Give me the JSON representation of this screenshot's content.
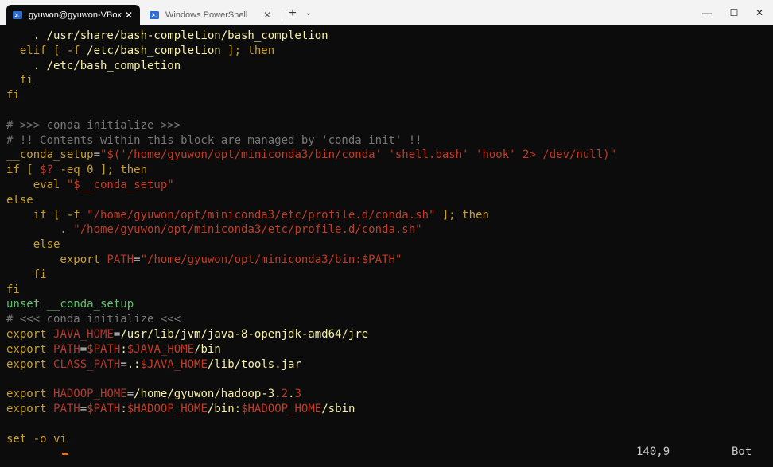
{
  "tabs": [
    {
      "title": "gyuwon@gyuwon-VBox:",
      "active": true
    },
    {
      "title": "Windows PowerShell",
      "active": false
    }
  ],
  "tabbar": {
    "new_tab": "+",
    "dropdown": "⌄",
    "close": "✕"
  },
  "window_controls": {
    "minimize": "—",
    "maximize": "☐",
    "close": "✕"
  },
  "colors": {
    "default": "#cccccc",
    "keyword": "#c7a030",
    "string": "#c23b22",
    "comment": "#767676",
    "var": "#b03a2e",
    "path": "#f9f1a5",
    "cyan": "#3a96dd",
    "green": "#61c16b"
  },
  "lines": [
    [
      {
        "t": "    . /usr/share/bash-completion/bash_completion",
        "c": "path"
      }
    ],
    [
      {
        "t": "  elif [ -f ",
        "c": "keyword"
      },
      {
        "t": "/etc/bash_completion",
        "c": "path"
      },
      {
        "t": " ]; then",
        "c": "keyword"
      }
    ],
    [
      {
        "t": "    . /etc/bash_completion",
        "c": "path"
      }
    ],
    [
      {
        "t": "  fi",
        "c": "keyword"
      }
    ],
    [
      {
        "t": "fi",
        "c": "keyword"
      }
    ],
    [
      {
        "t": "",
        "c": "default"
      }
    ],
    [
      {
        "t": "# >>> conda initialize >>>",
        "c": "comment"
      }
    ],
    [
      {
        "t": "# !! Contents within this block are managed by 'conda init' !!",
        "c": "comment"
      }
    ],
    [
      {
        "t": "__conda_setup",
        "c": "keyword"
      },
      {
        "t": "=",
        "c": "default"
      },
      {
        "t": "\"$('/home/gyuwon/opt/miniconda3/bin/conda' 'shell.bash' 'hook' 2> /dev/null)\"",
        "c": "string"
      }
    ],
    [
      {
        "t": "if [ ",
        "c": "keyword"
      },
      {
        "t": "$?",
        "c": "var"
      },
      {
        "t": " -eq 0 ]; then",
        "c": "keyword"
      }
    ],
    [
      {
        "t": "    eval ",
        "c": "keyword"
      },
      {
        "t": "\"$__conda_setup\"",
        "c": "string"
      }
    ],
    [
      {
        "t": "else",
        "c": "keyword"
      }
    ],
    [
      {
        "t": "    if [ -f ",
        "c": "keyword"
      },
      {
        "t": "\"/home/gyuwon/opt/miniconda3/etc/profile.d/conda.sh\"",
        "c": "string"
      },
      {
        "t": " ]; then",
        "c": "keyword"
      }
    ],
    [
      {
        "t": "        . ",
        "c": "keyword"
      },
      {
        "t": "\"/home/gyuwon/opt/miniconda3/etc/profile.d/conda.sh\"",
        "c": "string"
      }
    ],
    [
      {
        "t": "    else",
        "c": "keyword"
      }
    ],
    [
      {
        "t": "        export ",
        "c": "keyword"
      },
      {
        "t": "PATH",
        "c": "var"
      },
      {
        "t": "=",
        "c": "default"
      },
      {
        "t": "\"/home/gyuwon/opt/miniconda3/bin:$PATH\"",
        "c": "string"
      }
    ],
    [
      {
        "t": "    fi",
        "c": "keyword"
      }
    ],
    [
      {
        "t": "fi",
        "c": "keyword"
      }
    ],
    [
      {
        "t": "unset __conda_setup",
        "c": "green"
      }
    ],
    [
      {
        "t": "# <<< conda initialize <<<",
        "c": "comment"
      }
    ],
    [
      {
        "t": "export ",
        "c": "keyword"
      },
      {
        "t": "JAVA_HOME",
        "c": "var"
      },
      {
        "t": "=",
        "c": "default"
      },
      {
        "t": "/usr/lib/jvm/java-8-openjdk-amd64/jre",
        "c": "path"
      }
    ],
    [
      {
        "t": "export ",
        "c": "keyword"
      },
      {
        "t": "PATH",
        "c": "var"
      },
      {
        "t": "=",
        "c": "default"
      },
      {
        "t": "$PATH",
        "c": "string"
      },
      {
        "t": ":",
        "c": "path"
      },
      {
        "t": "$JAVA_HOME",
        "c": "string"
      },
      {
        "t": "/bin",
        "c": "path"
      }
    ],
    [
      {
        "t": "export ",
        "c": "keyword"
      },
      {
        "t": "CLASS_PATH",
        "c": "var"
      },
      {
        "t": "=",
        "c": "default"
      },
      {
        "t": ".:",
        "c": "path"
      },
      {
        "t": "$JAVA_HOME",
        "c": "string"
      },
      {
        "t": "/lib/tools.jar",
        "c": "path"
      }
    ],
    [
      {
        "t": "",
        "c": "default"
      }
    ],
    [
      {
        "t": "export ",
        "c": "keyword"
      },
      {
        "t": "HADOOP_HOME",
        "c": "var"
      },
      {
        "t": "=",
        "c": "default"
      },
      {
        "t": "/home/gyuwon/hadoop-3.",
        "c": "path"
      },
      {
        "t": "2",
        "c": "string"
      },
      {
        "t": ".",
        "c": "path"
      },
      {
        "t": "3",
        "c": "string"
      }
    ],
    [
      {
        "t": "export ",
        "c": "keyword"
      },
      {
        "t": "PATH",
        "c": "var"
      },
      {
        "t": "=",
        "c": "default"
      },
      {
        "t": "$PATH",
        "c": "string"
      },
      {
        "t": ":",
        "c": "path"
      },
      {
        "t": "$HADOOP_HOME",
        "c": "string"
      },
      {
        "t": "/bin:",
        "c": "path"
      },
      {
        "t": "$HADOOP_HOME",
        "c": "string"
      },
      {
        "t": "/sbin",
        "c": "path"
      }
    ],
    [
      {
        "t": "",
        "c": "default"
      }
    ],
    [
      {
        "t": "set -o vi",
        "c": "keyword"
      }
    ]
  ],
  "status": {
    "position": "140,9",
    "scroll": "Bot"
  }
}
